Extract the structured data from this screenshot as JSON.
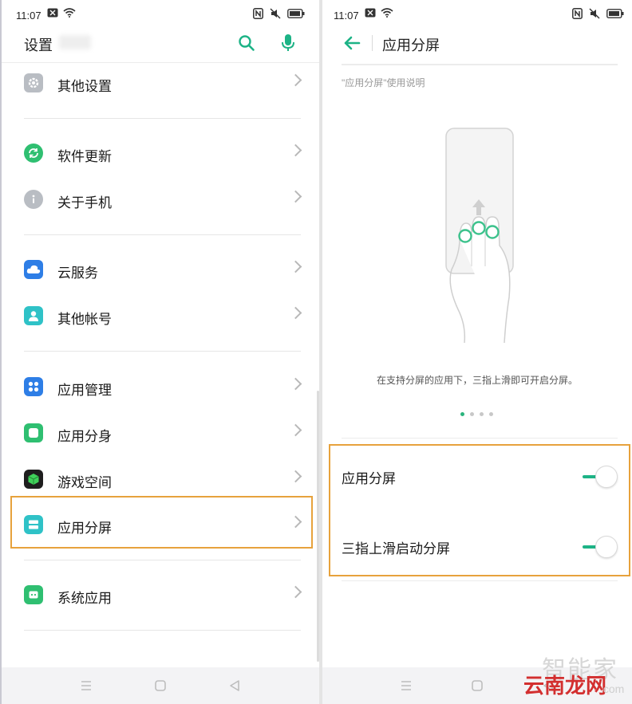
{
  "status_bar": {
    "time": "11:07"
  },
  "settings": {
    "title": "设置",
    "items": [
      {
        "label": "其他设置",
        "icon": "gear-icon",
        "color": "#b9bdc3"
      },
      {
        "label": "软件更新",
        "icon": "refresh-icon",
        "color": "#2fbf71"
      },
      {
        "label": "关于手机",
        "icon": "info-icon",
        "color": "#b9bdc3"
      },
      {
        "label": "云服务",
        "icon": "cloud-icon",
        "color": "#2e7ee6"
      },
      {
        "label": "其他帐号",
        "icon": "person-icon",
        "color": "#2fc2c7"
      },
      {
        "label": "应用管理",
        "icon": "apps-grid-icon",
        "color": "#2e7ee6"
      },
      {
        "label": "应用分身",
        "icon": "clone-icon",
        "color": "#2fbf71"
      },
      {
        "label": "游戏空间",
        "icon": "cube-icon",
        "color": "#1e1e1e"
      },
      {
        "label": "应用分屏",
        "icon": "split-screen-icon",
        "color": "#2fc2c7"
      },
      {
        "label": "系统应用",
        "icon": "robot-icon",
        "color": "#2fbf71"
      }
    ]
  },
  "split_screen": {
    "title": "应用分屏",
    "help_link": "\"应用分屏\"使用说明",
    "caption": "在支持分屏的应用下，三指上滑即可开启分屏。",
    "page_dots": {
      "count": 4,
      "active": 1
    },
    "toggles": [
      {
        "label": "应用分屏",
        "on": true
      },
      {
        "label": "三指上滑启动分屏",
        "on": true
      }
    ]
  },
  "watermark": {
    "line1": "智能家",
    "line2": "云南龙网",
    "line3": ".com"
  },
  "colors": {
    "accent": "#1db386",
    "highlight": "#e7a23c"
  }
}
